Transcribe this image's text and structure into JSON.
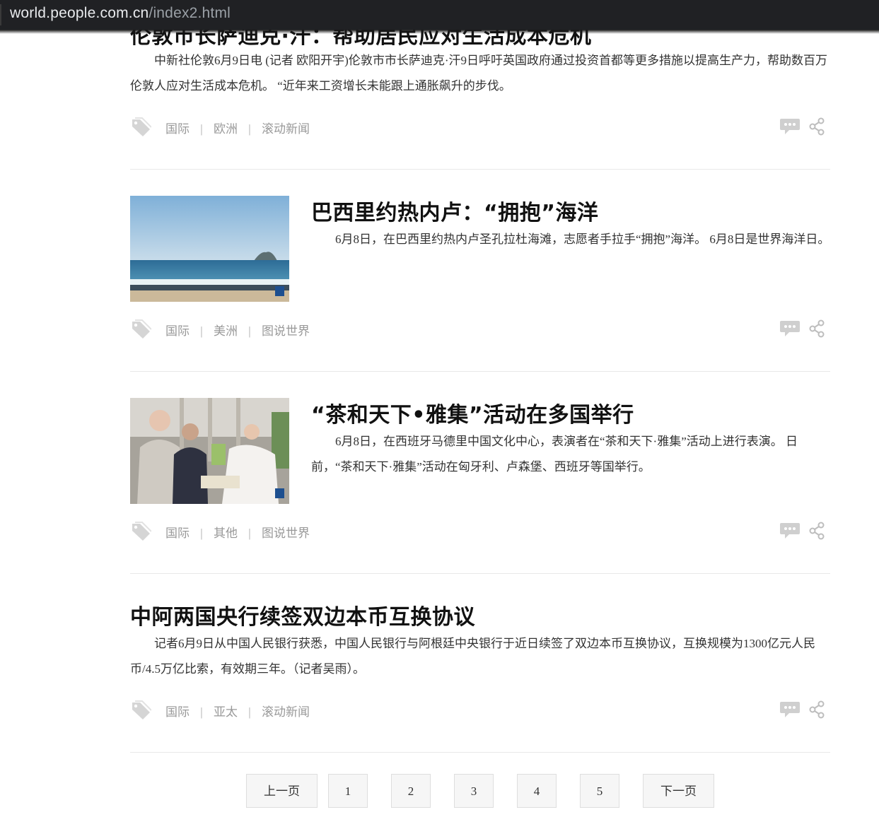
{
  "browser": {
    "url_host": "world.people.com.cn",
    "url_path": "/index2.html"
  },
  "articles": [
    {
      "title": "伦敦市长萨迪克·汗：帮助居民应对生活成本危机",
      "summary": "中新社伦敦6月9日电 (记者 欧阳开宇)伦敦市市长萨迪克·汗9日呼吁英国政府通过投资首都等更多措施以提高生产力，帮助数百万伦敦人应对生活成本危机。 “近年来工资增长未能跟上通胀飙升的步伐。",
      "tags": [
        "国际",
        "欧洲",
        "滚动新闻"
      ]
    },
    {
      "title": "巴西里约热内卢：“拥抱”海洋",
      "summary": "6月8日，在巴西里约热内卢圣孔拉杜海滩，志愿者手拉手“拥抱”海洋。 6月8日是世界海洋日。",
      "tags": [
        "国际",
        "美洲",
        "图说世界"
      ]
    },
    {
      "title": "“茶和天下•雅集”活动在多国举行",
      "summary": "6月8日，在西班牙马德里中国文化中心，表演者在“茶和天下·雅集”活动上进行表演。 日前，“茶和天下·雅集”活动在匈牙利、卢森堡、西班牙等国举行。",
      "tags": [
        "国际",
        "其他",
        "图说世界"
      ]
    },
    {
      "title": "中阿两国央行续签双边本币互换协议",
      "summary": "记者6月9日从中国人民银行获悉，中国人民银行与阿根廷中央银行于近日续签了双边本币互换协议，互换规模为1300亿元人民币/4.5万亿比索，有效期三年。（记者吴雨）。",
      "tags": [
        "国际",
        "亚太",
        "滚动新闻"
      ]
    }
  ],
  "tag_separator": "|",
  "pagination": {
    "prev": "上一页",
    "pages": [
      "1",
      "2",
      "3",
      "4",
      "5"
    ],
    "next": "下一页"
  }
}
